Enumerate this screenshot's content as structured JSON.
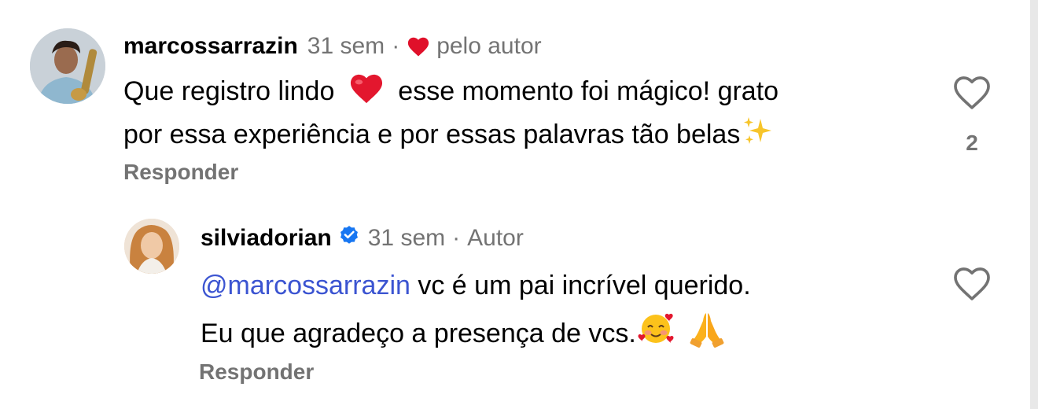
{
  "comments": [
    {
      "username": "marcossarrazin",
      "time": "31 sem",
      "separator": "·",
      "liked_by_author_label": "pelo autor",
      "text_part1": "Que registro lindo",
      "text_part2": "esse momento foi mágico! grato",
      "text_line2": "por essa experiência e por essas palavras tão belas",
      "reply_label": "Responder",
      "like_count": "2",
      "icons": [
        "heart-red-icon",
        "red-heart-emoji",
        "sparkles-emoji",
        "heart-outline-icon"
      ]
    },
    {
      "username": "silviadorian",
      "verified": true,
      "time": "31 sem",
      "separator": "·",
      "author_label": "Autor",
      "mention": "@marcossarrazin",
      "text_part1": "vc é um pai incrível querido.",
      "text_line2": "Eu que agradeço a presença de vcs.",
      "reply_label": "Responder",
      "icons": [
        "verified-badge-icon",
        "smiling-face-with-hearts-emoji",
        "folded-hands-emoji",
        "heart-outline-icon"
      ]
    }
  ],
  "colors": {
    "muted": "#737373",
    "mention": "#3b54d1",
    "heart_red": "#e0102a",
    "verified_blue": "#1877f2"
  }
}
